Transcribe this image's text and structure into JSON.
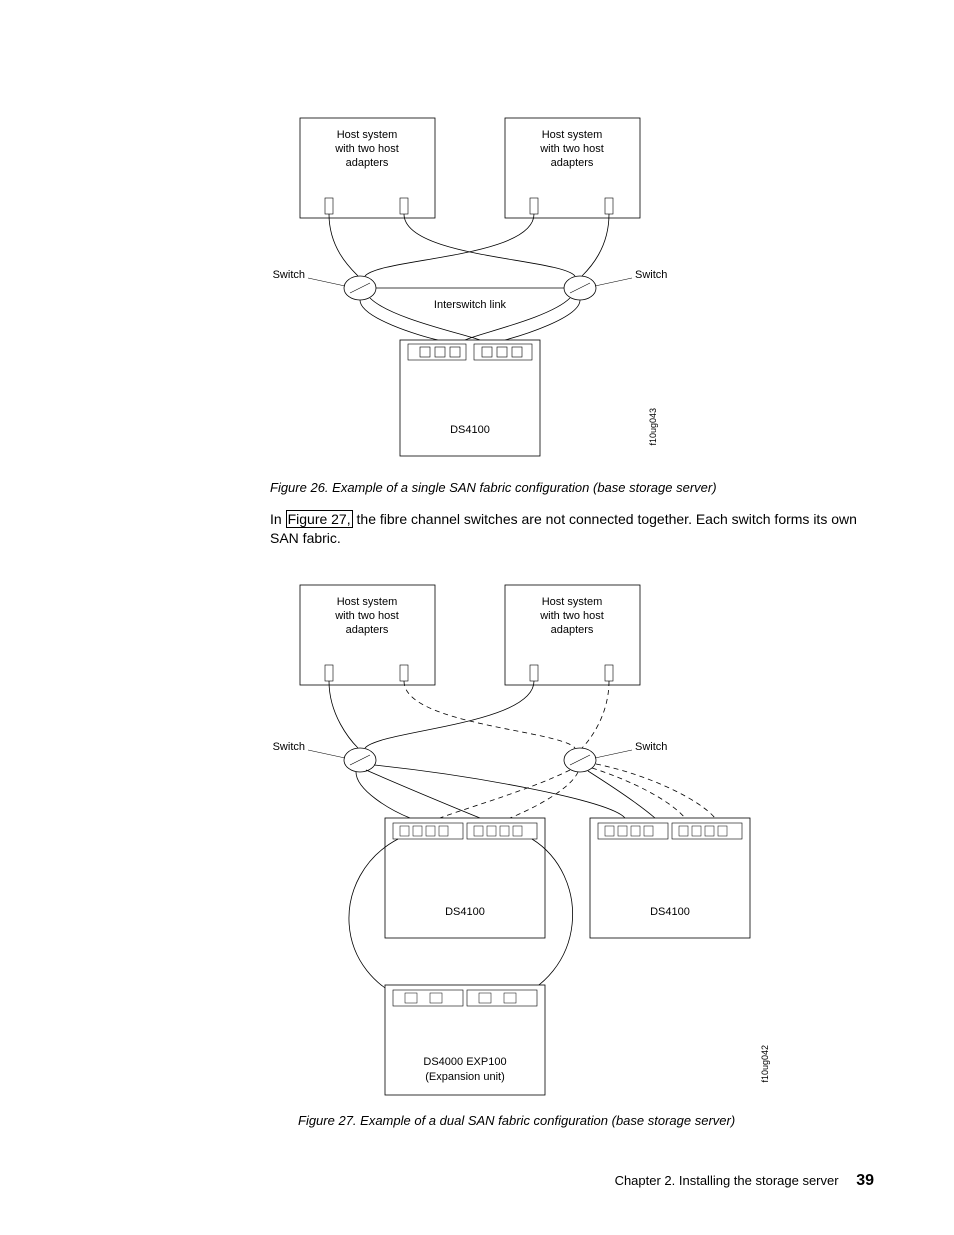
{
  "figure26": {
    "host1_line1": "Host system",
    "host1_line2": "with two host",
    "host1_line3": "adapters",
    "host2_line1": "Host system",
    "host2_line2": "with two host",
    "host2_line3": "adapters",
    "switch_left": "Switch",
    "switch_right": "Switch",
    "interswitch": "Interswitch link",
    "ds4100": "DS4100",
    "imgid": "f10ug043",
    "caption": "Figure 26. Example of a single SAN fabric configuration (base storage server)"
  },
  "paragraph": {
    "part1": "In ",
    "link": "Figure 27,",
    "part2": " the fibre channel switches are not connected together. Each switch forms its own SAN fabric."
  },
  "figure27": {
    "host1_line1": "Host system",
    "host1_line2": "with two host",
    "host1_line3": "adapters",
    "host2_line1": "Host system",
    "host2_line2": "with two host",
    "host2_line3": "adapters",
    "switch_left": "Switch",
    "switch_right": "Switch",
    "ds4100_a": "DS4100",
    "ds4100_b": "DS4100",
    "exp_line1": "DS4000 EXP100",
    "exp_line2": "(Expansion unit)",
    "imgid": "f10ug042",
    "caption": "Figure 27. Example of a dual SAN fabric configuration (base storage server)"
  },
  "footer": {
    "chapter": "Chapter 2. Installing the storage server",
    "page": "39"
  }
}
